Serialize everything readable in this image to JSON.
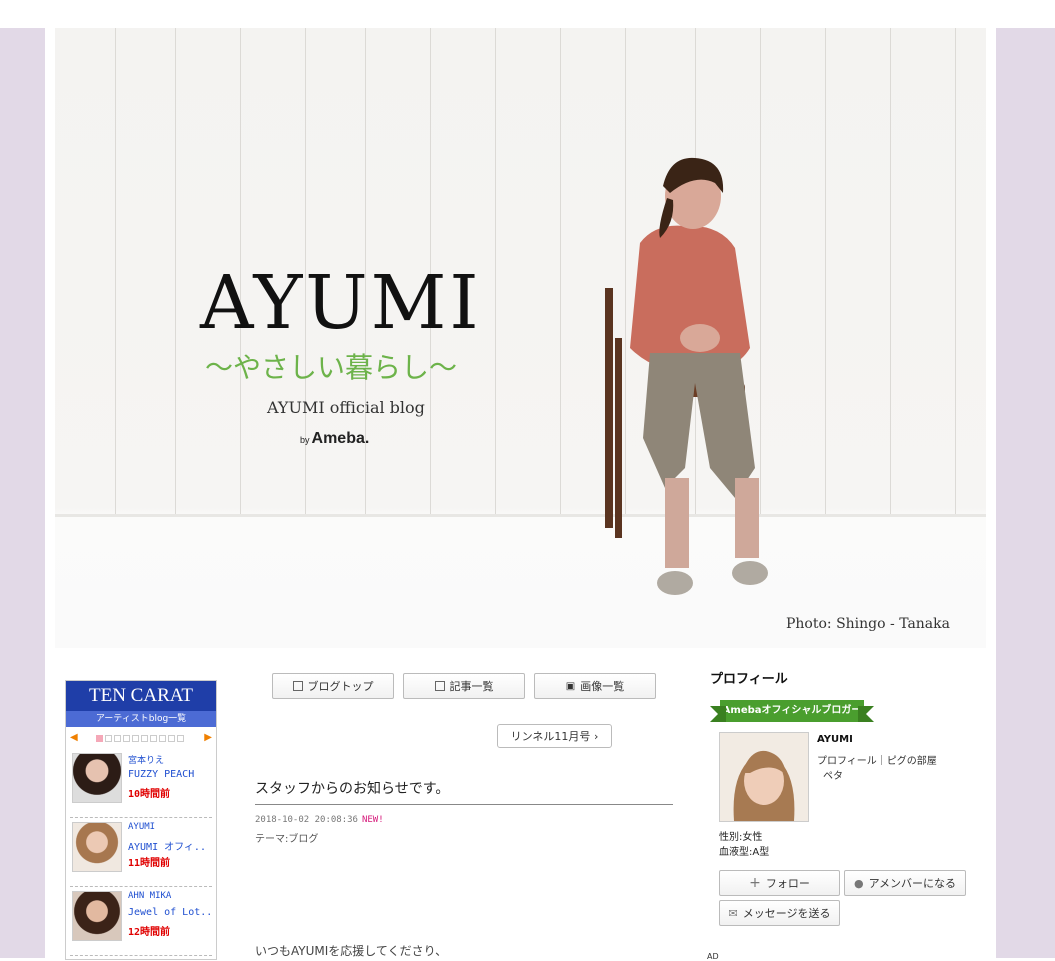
{
  "header": {
    "title": "AYUMI",
    "subtitle": "〜やさしい暮らし〜",
    "tagline": "AYUMI official blog",
    "by_prefix": "by",
    "by_brand": "Ameba.",
    "photo_credit": "Photo: Shingo - Tanaka"
  },
  "widget": {
    "title": "TEN CARAT",
    "subtitle": "アーティストblog一覧",
    "items": [
      {
        "name": "宮本りえ",
        "title": "FUZZY PEACH",
        "time": "10時間前"
      },
      {
        "name": "AYUMI",
        "title": "AYUMI オフィ..",
        "time": "11時間前"
      },
      {
        "name": "AHN MIKA",
        "title": "Jewel of Lot..",
        "time": "12時間前"
      }
    ]
  },
  "nav": {
    "blog_top": "ブログトップ",
    "article_list": "記事一覧",
    "image_list": "画像一覧",
    "linnel_link": "リンネル11月号"
  },
  "entry": {
    "title": "スタッフからのお知らせです。",
    "date": "2018-10-02 20:08:36",
    "new_label": "NEW!",
    "theme": "テーマ:ブログ",
    "body_start": "いつもAYUMIを応援してくださり、"
  },
  "profile": {
    "heading": "プロフィール",
    "badge": "Amebaオフィシャルブロガー",
    "name": "AYUMI",
    "links": "プロフィール｜ピグの部屋",
    "peta": "ペタ",
    "gender": "性別:女性",
    "blood": "血液型:A型",
    "follow": "フォロー",
    "amember": "アメンバーになる",
    "message": "メッセージを送る",
    "ad": "AD"
  },
  "colors": {
    "lavender_bg": "#e2d9e7",
    "widget_blue": "#1f3ea8",
    "subtitle_green": "#6db34a",
    "badge_green": "#4a9e2e",
    "new_pink": "#d6187a"
  }
}
